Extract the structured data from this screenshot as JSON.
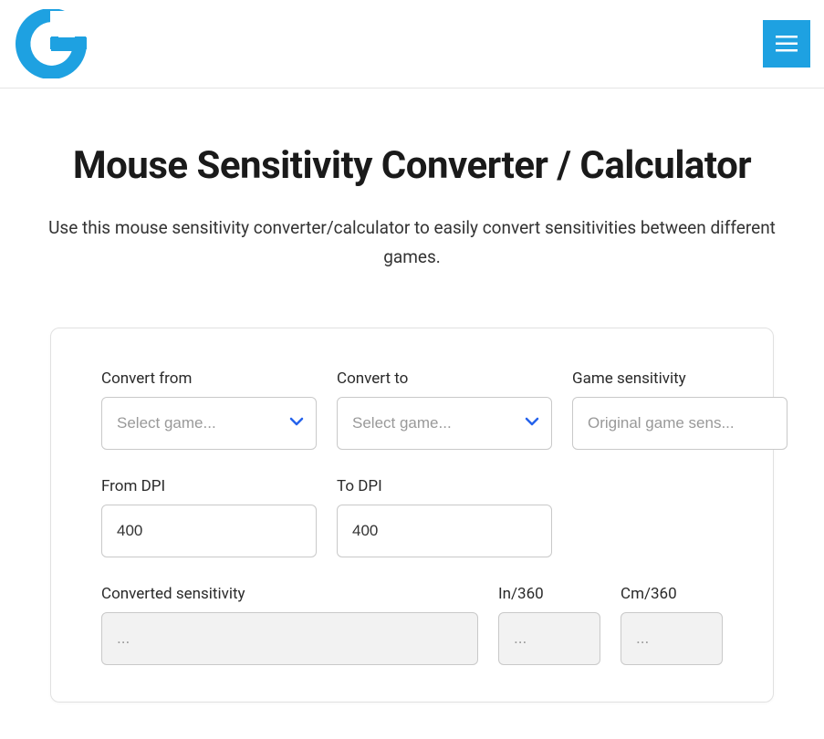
{
  "header": {
    "logo_alt": "G logo",
    "menu_alt": "Menu"
  },
  "page": {
    "title": "Mouse Sensitivity Converter / Calculator",
    "subtitle": "Use this mouse sensitivity converter/calculator to easily convert sensitivities between different games."
  },
  "form": {
    "convert_from": {
      "label": "Convert from",
      "placeholder": "Select game..."
    },
    "convert_to": {
      "label": "Convert to",
      "placeholder": "Select game..."
    },
    "game_sensitivity": {
      "label": "Game sensitivity",
      "placeholder": "Original game sens..."
    },
    "from_dpi": {
      "label": "From DPI",
      "value": "400"
    },
    "to_dpi": {
      "label": "To DPI",
      "value": "400"
    },
    "converted_sensitivity": {
      "label": "Converted sensitivity",
      "placeholder": "..."
    },
    "in_360": {
      "label": "In/360",
      "placeholder": "..."
    },
    "cm_360": {
      "label": "Cm/360",
      "placeholder": "..."
    }
  },
  "colors": {
    "accent": "#1ea1e1",
    "chevron": "#2563eb"
  }
}
